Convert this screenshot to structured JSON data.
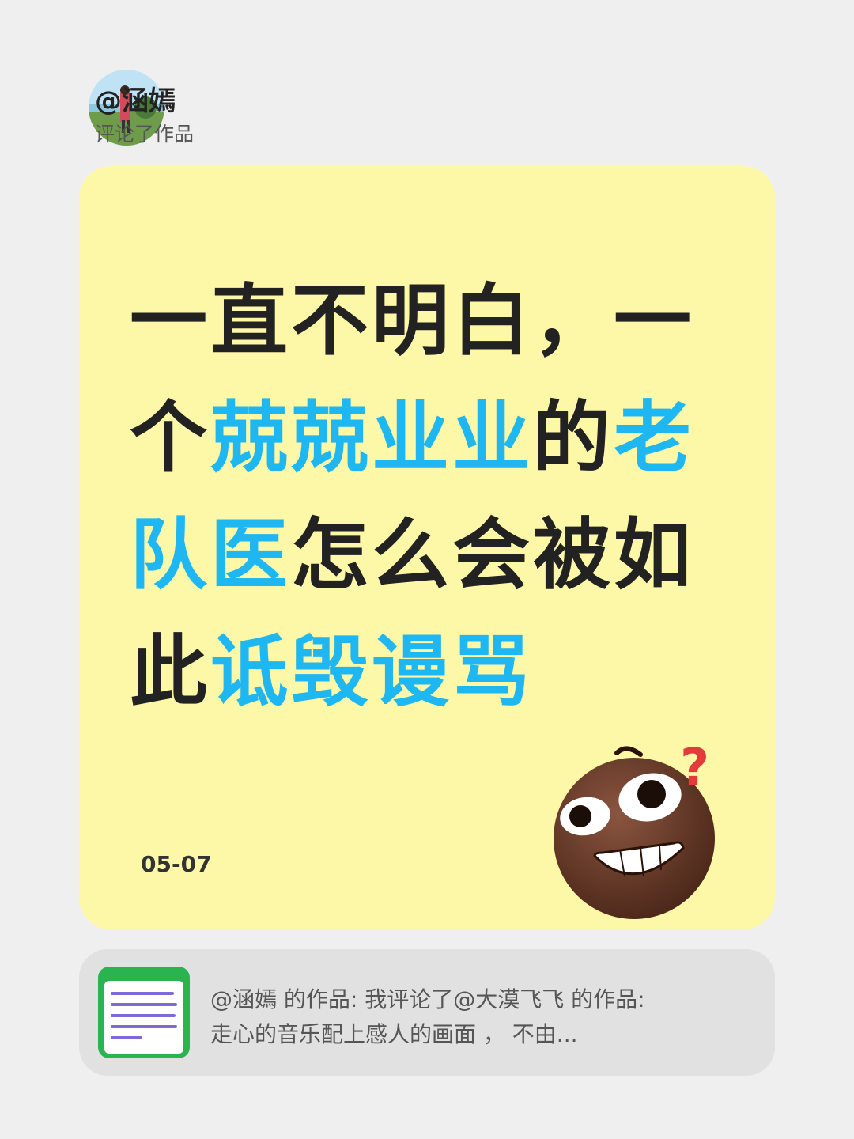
{
  "header": {
    "username": "@涵嫣",
    "action": "评论了作品"
  },
  "card": {
    "headline_parts": [
      {
        "text": "一直不明白，一",
        "highlight": false
      },
      {
        "text": "个",
        "highlight": false
      },
      {
        "text": "兢兢业业",
        "highlight": true
      },
      {
        "text": "的",
        "highlight": false
      },
      {
        "text": "老",
        "highlight": true
      },
      {
        "text": "队医",
        "highlight": true
      },
      {
        "text": "怎么会被如",
        "highlight": false
      },
      {
        "text": "此",
        "highlight": false
      },
      {
        "text": "诋毁谩骂",
        "highlight": true
      }
    ],
    "date": "05-07",
    "emoji_icon": "grinning-brown-face-question-icon"
  },
  "reference": {
    "line1": "@涵嫣  的作品: 我评论了@大漠飞飞 的作品:",
    "line2": "走心的音乐配上感人的画面 ， 不由..."
  },
  "colors": {
    "background": "#efefef",
    "card": "#fdf8a8",
    "highlight": "#1fb7f2",
    "text": "#222222",
    "reference_bg": "#e1e1e1"
  }
}
